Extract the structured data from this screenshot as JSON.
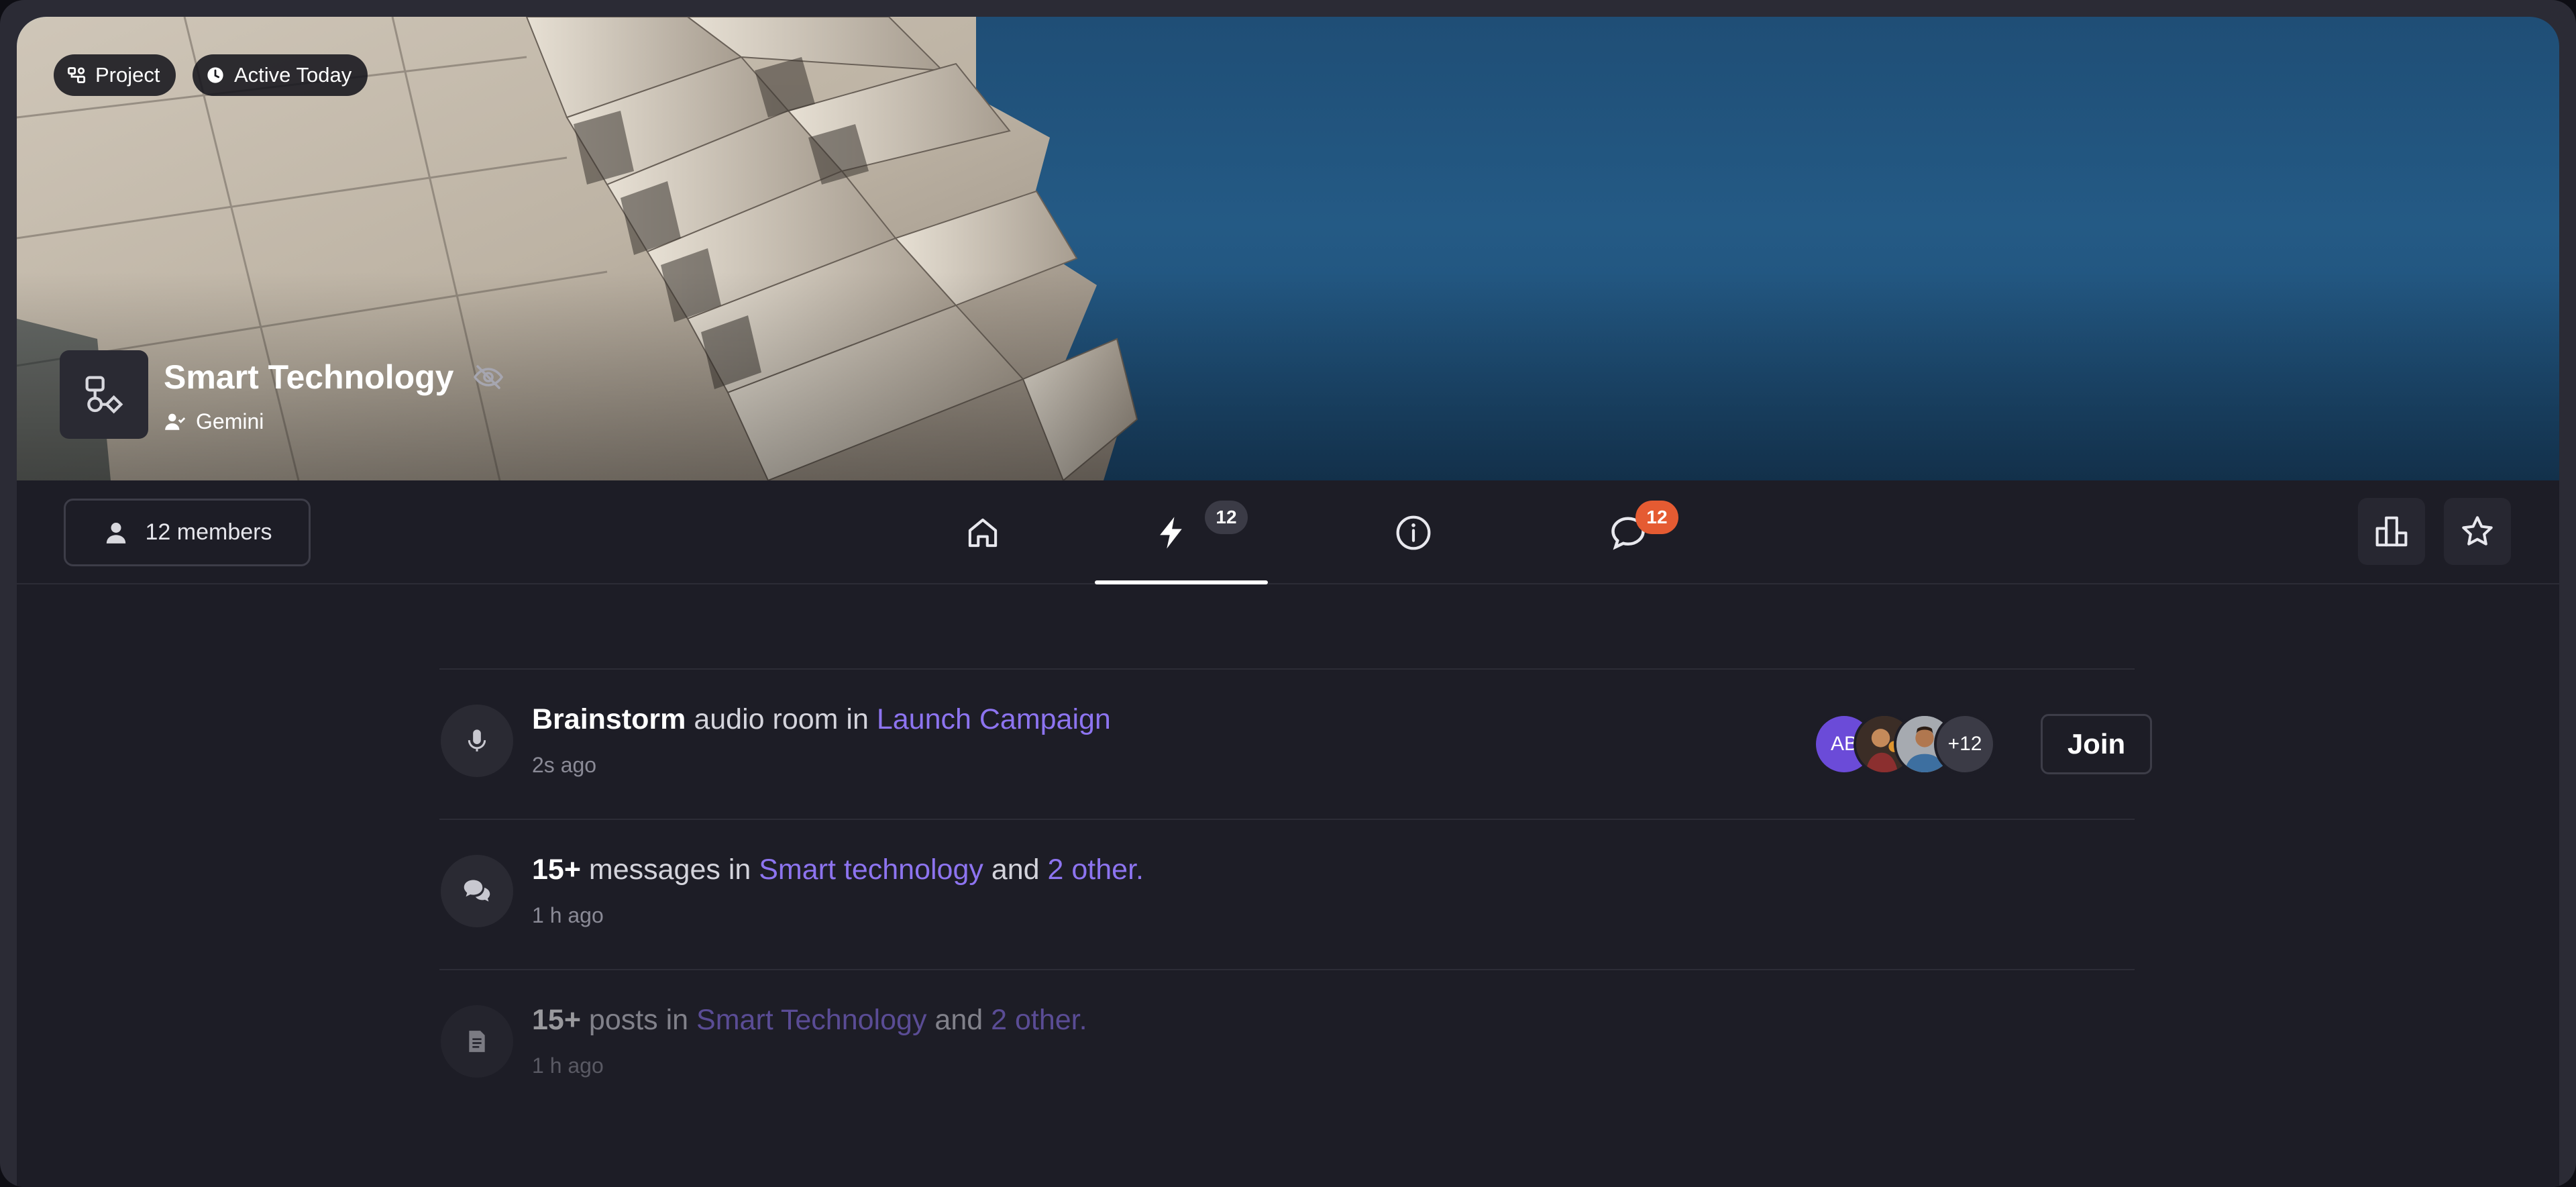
{
  "banner": {
    "chips": [
      {
        "label": "Project",
        "icon": "flow-icon"
      },
      {
        "label": "Active Today",
        "icon": "clock-icon"
      }
    ],
    "title": "Smart Technology",
    "owner": "Gemini",
    "title_icon": "eye-off-icon"
  },
  "toolbar": {
    "members_label": "12 members",
    "tabs": [
      {
        "icon": "home-icon"
      },
      {
        "icon": "lightning-icon",
        "badge": "12"
      },
      {
        "icon": "info-icon"
      },
      {
        "icon": "chat-icon",
        "badge": "12"
      }
    ],
    "actions": [
      {
        "icon": "leaderboard-icon"
      },
      {
        "icon": "star-icon"
      }
    ]
  },
  "feed": [
    {
      "icon": "microphone-icon",
      "bold": "Brainstorm",
      "text1": " audio room in ",
      "link1": "Launch Campaign",
      "time": "2s ago",
      "avatars": {
        "initials": "AB",
        "more": "+12"
      },
      "join_label": "Join"
    },
    {
      "icon": "chat-bubbles-icon",
      "bold": "15+",
      "text1": " messages in ",
      "link1": "Smart technology",
      "text2": " and ",
      "link2": "2 other.",
      "time": "1 h ago"
    },
    {
      "icon": "document-icon",
      "bold": "15+",
      "text1": " posts in ",
      "link1": "Smart Technology",
      "text2": " and ",
      "link2": "2 other.",
      "time": "1 h ago"
    }
  ],
  "colors": {
    "accent": "#8d74f0",
    "badge_orange": "#e55b32",
    "background": "#1d1d26"
  }
}
